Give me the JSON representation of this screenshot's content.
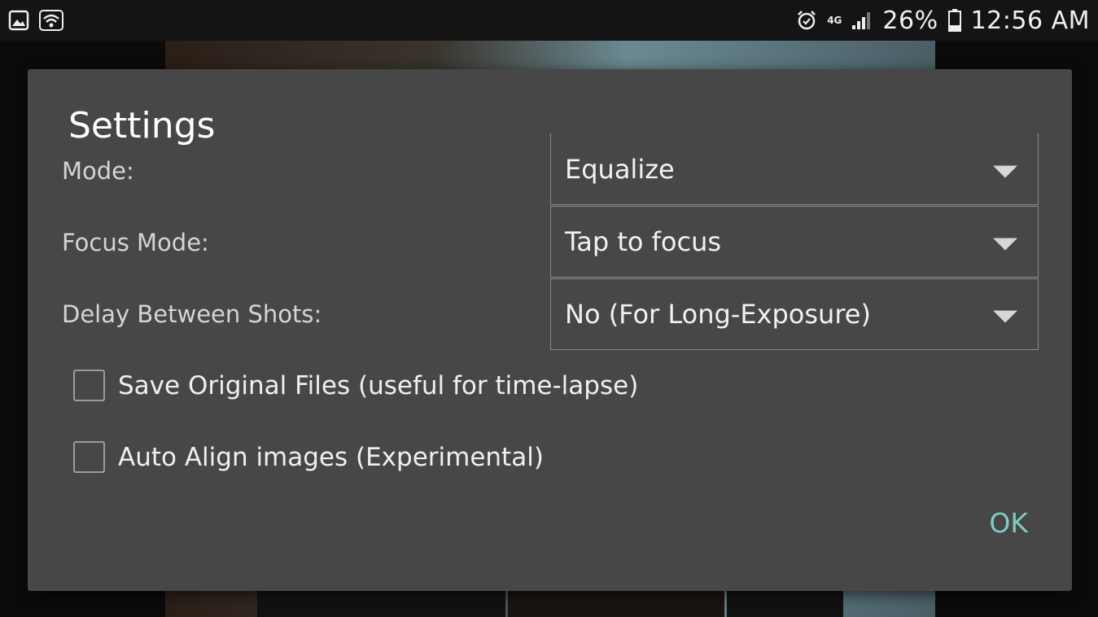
{
  "status_bar": {
    "network": "4G",
    "battery_percent": "26%",
    "time": "12:56 AM",
    "icons": [
      "gallery-icon",
      "wifi-icon",
      "alarm-icon",
      "signal-icon",
      "battery-icon"
    ]
  },
  "dialog": {
    "title": "Settings",
    "rows": [
      {
        "label": "Mode:",
        "value": "Equalize"
      },
      {
        "label": "Focus Mode:",
        "value": "Tap to focus"
      },
      {
        "label": "Delay Between Shots:",
        "value": "No (For Long-Exposure)"
      }
    ],
    "checkboxes": [
      {
        "label": "Save Original Files (useful for time-lapse)",
        "checked": false
      },
      {
        "label": "Auto Align images (Experimental)",
        "checked": false
      }
    ],
    "ok_label": "OK"
  },
  "colors": {
    "dialog_bg": "#474747",
    "accent": "#80cbc4",
    "status_bar_bg": "#141414"
  }
}
